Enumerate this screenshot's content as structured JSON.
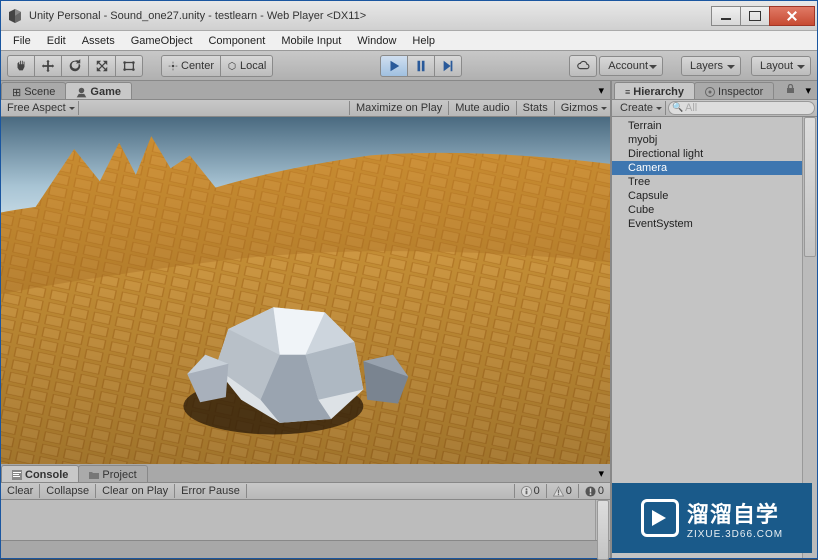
{
  "window": {
    "title": "Unity Personal - Sound_one27.unity - testlearn - Web Player <DX11>"
  },
  "menu": {
    "items": [
      "File",
      "Edit",
      "Assets",
      "GameObject",
      "Component",
      "Mobile Input",
      "Window",
      "Help"
    ]
  },
  "toolbar": {
    "center": "Center",
    "local": "Local",
    "account": "Account",
    "layers": "Layers",
    "layout": "Layout"
  },
  "gametabs": {
    "scene": "Scene",
    "game": "Game"
  },
  "gamebar": {
    "aspect": "Free Aspect",
    "maxplay": "Maximize on Play",
    "mute": "Mute audio",
    "stats": "Stats",
    "gizmos": "Gizmos"
  },
  "console": {
    "tab_console": "Console",
    "tab_project": "Project",
    "clear": "Clear",
    "collapse": "Collapse",
    "clearplay": "Clear on Play",
    "errorpause": "Error Pause",
    "info_count": "0",
    "warn_count": "0",
    "err_count": "0"
  },
  "hier": {
    "tab_hier": "Hierarchy",
    "tab_insp": "Inspector",
    "create": "Create",
    "search_placeholder": "All",
    "items": [
      "Terrain",
      "myobj",
      "Directional light",
      "Camera",
      "Tree",
      "Capsule",
      "Cube",
      "EventSystem"
    ],
    "selected": 3
  },
  "watermark": {
    "big": "溜溜自学",
    "small": "ZIXUE.3D66.COM"
  }
}
